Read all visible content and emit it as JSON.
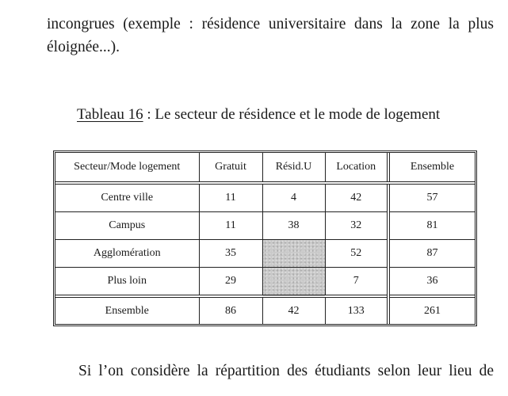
{
  "document": {
    "paragraph_top": {
      "line1": "incongrues (exemple : résidence universitaire dans la zone la plus",
      "line2": "éloignée...)."
    },
    "caption": {
      "label": "Tableau 16",
      "separator": " : ",
      "text": "Le secteur de résidence et le mode de logement"
    },
    "table": {
      "headers": [
        "Secteur/Mode logement",
        "Gratuit",
        "Résid.U",
        "Location",
        "Ensemble"
      ],
      "rows": [
        {
          "label": "Centre ville",
          "gratuit": "11",
          "resid_u": "4",
          "location": "42",
          "ensemble": "57"
        },
        {
          "label": "Campus",
          "gratuit": "11",
          "resid_u": "38",
          "location": "32",
          "ensemble": "81"
        },
        {
          "label": "Agglomération",
          "gratuit": "35",
          "resid_u": "",
          "location": "52",
          "ensemble": "87"
        },
        {
          "label": "Plus loin",
          "gratuit": "29",
          "resid_u": "",
          "location": "7",
          "ensemble": "36"
        }
      ],
      "total": {
        "label": "Ensemble",
        "gratuit": "86",
        "resid_u": "42",
        "location": "133",
        "ensemble": "261"
      },
      "shaded_cells": [
        "Agglomération/Résid.U",
        "Plus loin/Résid.U"
      ]
    },
    "paragraph_bottom": "Si l’on considère la répartition des étudiants selon leur lieu de"
  }
}
